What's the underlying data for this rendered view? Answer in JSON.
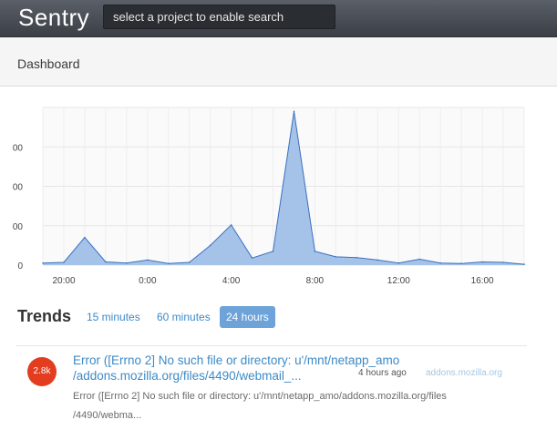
{
  "header": {
    "brand": "Sentry",
    "search_placeholder": "select a project to enable search"
  },
  "subheader": {
    "title": "Dashboard"
  },
  "chart_data": {
    "type": "area",
    "x": [
      "19:00",
      "20:00",
      "21:00",
      "22:00",
      "23:00",
      "0:00",
      "1:00",
      "2:00",
      "3:00",
      "4:00",
      "5:00",
      "6:00",
      "7:00",
      "8:00",
      "9:00",
      "10:00",
      "11:00",
      "12:00",
      "13:00",
      "14:00",
      "15:00",
      "16:00",
      "17:00",
      "18:00"
    ],
    "values": [
      5,
      7,
      70,
      8,
      5,
      13,
      4,
      7,
      50,
      102,
      18,
      35,
      390,
      35,
      21,
      19,
      13,
      5,
      15,
      5,
      4,
      8,
      7,
      2
    ],
    "xtick_labels": [
      "20:00",
      "0:00",
      "4:00",
      "8:00",
      "12:00",
      "16:00"
    ],
    "ytick_labels": [
      "0",
      "00",
      "00",
      "00"
    ],
    "ylim": [
      0,
      400
    ],
    "grid": true,
    "color": "#a5c3e8",
    "line_color": "#3a6fc0"
  },
  "trends": {
    "title": "Trends",
    "ranges": [
      {
        "label": "15 minutes",
        "active": false
      },
      {
        "label": "60 minutes",
        "active": false
      },
      {
        "label": "24 hours",
        "active": true
      }
    ]
  },
  "issues": [
    {
      "count": "2.8k",
      "title_line1": "Error ([Errno 2] No such file or directory: u'/mnt/netapp_amo",
      "title_line2": "/addons.mozilla.org/files/4490/webmail_...",
      "time": "4 hours ago",
      "project": "addons.mozilla.org",
      "message_line1": "Error ([Errno 2] No such file or directory: u'/mnt/netapp_amo/addons.mozilla.org/files",
      "message_line2": "/4490/webma..."
    }
  ],
  "colors": {
    "accent": "#3d8ac7",
    "badge": "#e33c1e",
    "active_tab": "#6ea3d9"
  }
}
